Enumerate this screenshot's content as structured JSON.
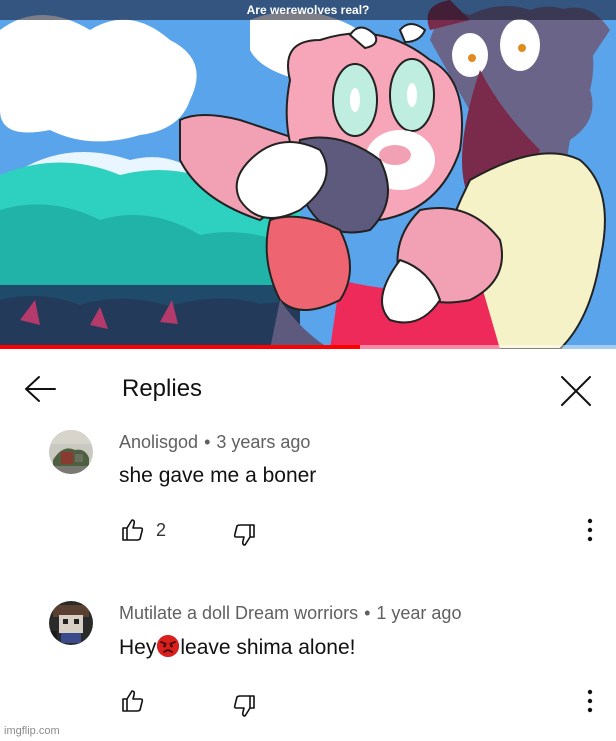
{
  "video": {
    "title": "Are werewolves real?",
    "progress": 0.585
  },
  "panel": {
    "title": "Replies",
    "back_icon": "arrow-left-icon",
    "close_icon": "close-icon"
  },
  "comments": [
    {
      "author": "Anolisgod",
      "separator": "•",
      "time": "3 years ago",
      "text": "she gave me a boner",
      "likes": "2"
    },
    {
      "author": "Mutilate a doll Dream worriors",
      "separator": "•",
      "time": "1 year ago",
      "text_before": "Hey",
      "emoji": "angry-face-emoji",
      "text_after": "leave shima alone!",
      "likes": ""
    }
  ],
  "watermark": "imgflip.com",
  "colors": {
    "progress": "#ff0000",
    "text": "#111111",
    "meta": "#606060"
  }
}
